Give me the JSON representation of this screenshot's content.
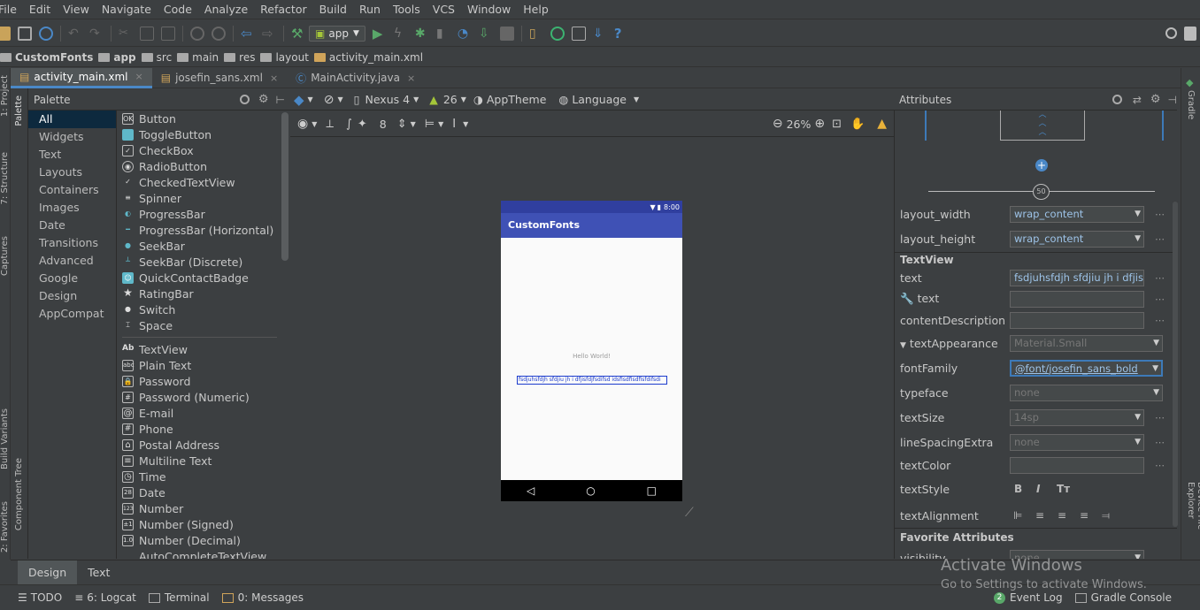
{
  "menu": [
    "File",
    "Edit",
    "View",
    "Navigate",
    "Code",
    "Analyze",
    "Refactor",
    "Build",
    "Run",
    "Tools",
    "VCS",
    "Window",
    "Help"
  ],
  "toolbar": {
    "run_config": "app"
  },
  "breadcrumbs": [
    "CustomFonts",
    "app",
    "src",
    "main",
    "res",
    "layout",
    "activity_main.xml"
  ],
  "editor_tabs": [
    {
      "label": "activity_main.xml",
      "active": true
    },
    {
      "label": "josefin_sans.xml",
      "active": false
    },
    {
      "label": "MainActivity.java",
      "active": false
    }
  ],
  "palette": {
    "title": "Palette",
    "categories": [
      "All",
      "Widgets",
      "Text",
      "Layouts",
      "Containers",
      "Images",
      "Date",
      "Transitions",
      "Advanced",
      "Google",
      "Design",
      "AppCompat"
    ],
    "widgets": [
      {
        "icon": "OK",
        "label": "Button"
      },
      {
        "icon": "",
        "label": "ToggleButton"
      },
      {
        "icon": "✓",
        "label": "CheckBox"
      },
      {
        "icon": "◉",
        "label": "RadioButton"
      },
      {
        "icon": "✓",
        "label": "CheckedTextView"
      },
      {
        "icon": "≡",
        "label": "Spinner"
      },
      {
        "icon": "◐",
        "label": "ProgressBar"
      },
      {
        "icon": "━",
        "label": "ProgressBar (Horizontal)"
      },
      {
        "icon": "●",
        "label": "SeekBar"
      },
      {
        "icon": "┴",
        "label": "SeekBar (Discrete)"
      },
      {
        "icon": "☺",
        "label": "QuickContactBadge"
      },
      {
        "icon": "★",
        "label": "RatingBar"
      },
      {
        "icon": "●",
        "label": "Switch"
      },
      {
        "icon": "⌶",
        "label": "Space"
      }
    ],
    "text_items": [
      {
        "icon": "Ab",
        "label": "TextView"
      },
      {
        "icon": "abc",
        "label": "Plain Text"
      },
      {
        "icon": "🔒",
        "label": "Password"
      },
      {
        "icon": "#",
        "label": "Password (Numeric)"
      },
      {
        "icon": "@",
        "label": "E-mail"
      },
      {
        "icon": "#",
        "label": "Phone"
      },
      {
        "icon": "⌂",
        "label": "Postal Address"
      },
      {
        "icon": "≡",
        "label": "Multiline Text"
      },
      {
        "icon": "◷",
        "label": "Time"
      },
      {
        "icon": "28",
        "label": "Date"
      },
      {
        "icon": "123",
        "label": "Number"
      },
      {
        "icon": "±1",
        "label": "Number (Signed)"
      },
      {
        "icon": "1.0",
        "label": "Number (Decimal)"
      },
      {
        "icon": "",
        "label": "AutoCompleteTextView"
      }
    ]
  },
  "design_toolbar": {
    "device": "Nexus 4",
    "api": "26",
    "theme": "AppTheme",
    "language": "Language",
    "margin": "8",
    "zoom": "26%"
  },
  "device": {
    "time": "8:00",
    "app_title": "CustomFonts",
    "hello": "Hello World!",
    "selected_text": "fsdjuhsfdjh sfdjiu jh  i dfjisfdjfsdifsd   idsfisdfisdfisfdifsdi"
  },
  "attributes": {
    "title": "Attributes",
    "margin_value": "50",
    "layout_width_label": "layout_width",
    "layout_width": "wrap_content",
    "layout_height_label": "layout_height",
    "layout_height": "wrap_content",
    "section_textview": "TextView",
    "text_label": "text",
    "text_value": "fsdjuhsfdjh sfdjiu jh  i dfjisfdjfsdifsd",
    "tools_text_label": "text",
    "content_desc_label": "contentDescription",
    "text_appearance_label": "textAppearance",
    "text_appearance": "Material.Small",
    "font_family_label": "fontFamily",
    "font_family": "@font/josefin_sans_bold",
    "typeface_label": "typeface",
    "typeface": "none",
    "text_size_label": "textSize",
    "text_size": "14sp",
    "line_spacing_label": "lineSpacingExtra",
    "line_spacing": "none",
    "text_color_label": "textColor",
    "text_style_label": "textStyle",
    "text_alignment_label": "textAlignment",
    "favorites_section": "Favorite Attributes",
    "visibility_label": "visibility",
    "visibility_value": "none"
  },
  "bottom_tabs": [
    "Design",
    "Text"
  ],
  "left_tool_windows": [
    "1: Project",
    "7: Structure",
    "Captures",
    "Build Variants",
    "2: Favorites"
  ],
  "palette_side_tab": "Palette",
  "component_tree_tab": "Component Tree",
  "right_tool_windows": [
    "Gradle",
    "Device File Explorer"
  ],
  "status_bar": {
    "todo": "TODO",
    "logcat": "6: Logcat",
    "terminal": "Terminal",
    "messages": "0: Messages",
    "event_log": "Event Log",
    "event_log_count": "2",
    "gradle_console": "Gradle Console"
  },
  "watermark": {
    "line1": "Activate Windows",
    "line2": "Go to Settings to activate Windows."
  },
  "colors": {
    "accent": "#4a88c7",
    "app_bar": "#3f51b5",
    "status_bar": "#303f9f",
    "run_green": "#59a869"
  }
}
